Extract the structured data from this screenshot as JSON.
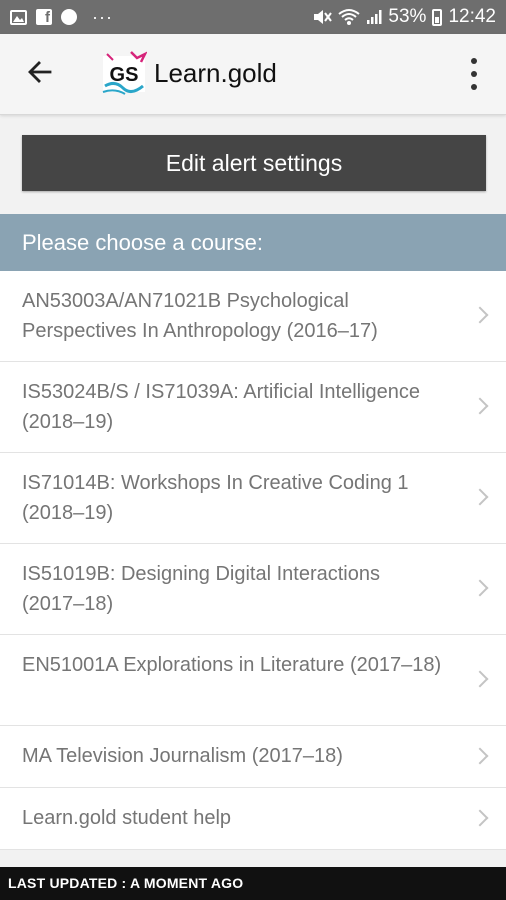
{
  "status_bar": {
    "battery": "53%",
    "time": "12:42",
    "left_icons": [
      "image-icon",
      "facebook-icon",
      "messenger-icon",
      "more-notifications-icon"
    ],
    "right_icons": [
      "mute-icon",
      "wifi-icon",
      "signal-icon",
      "battery-icon"
    ]
  },
  "app_bar": {
    "logo_text": "GS",
    "title": "Learn.gold"
  },
  "edit_button": {
    "label": "Edit alert settings"
  },
  "section_header": {
    "label": "Please choose a course:"
  },
  "courses": [
    {
      "label": "AN53003A/AN71021B Psychological Perspectives In Anthropology (2016–17)"
    },
    {
      "label": "IS53024B/S / IS71039A: Artificial Intelligence (2018–19)"
    },
    {
      "label": "IS71014B: Workshops In Creative Coding 1 (2018–19)"
    },
    {
      "label": "IS51019B: Designing Digital Interactions (2017–18)"
    },
    {
      "label": "EN51001A Explorations in Literature (2017–18)"
    },
    {
      "label": "MA Television Journalism (2017–18)"
    },
    {
      "label": "Learn.gold student help"
    }
  ],
  "footer": {
    "label": "LAST UPDATED : A MOMENT AGO"
  },
  "colors": {
    "status_bar": "#6e6e6e",
    "header_band": "#8aa3b3",
    "button_bg": "#454545",
    "footer_bg": "#111111"
  }
}
